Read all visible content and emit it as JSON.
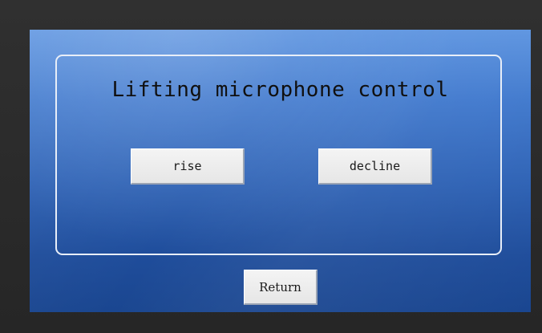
{
  "screen": {
    "title": "Lifting microphone control",
    "buttons": {
      "rise": "rise",
      "decline": "decline",
      "return": "Return"
    }
  }
}
